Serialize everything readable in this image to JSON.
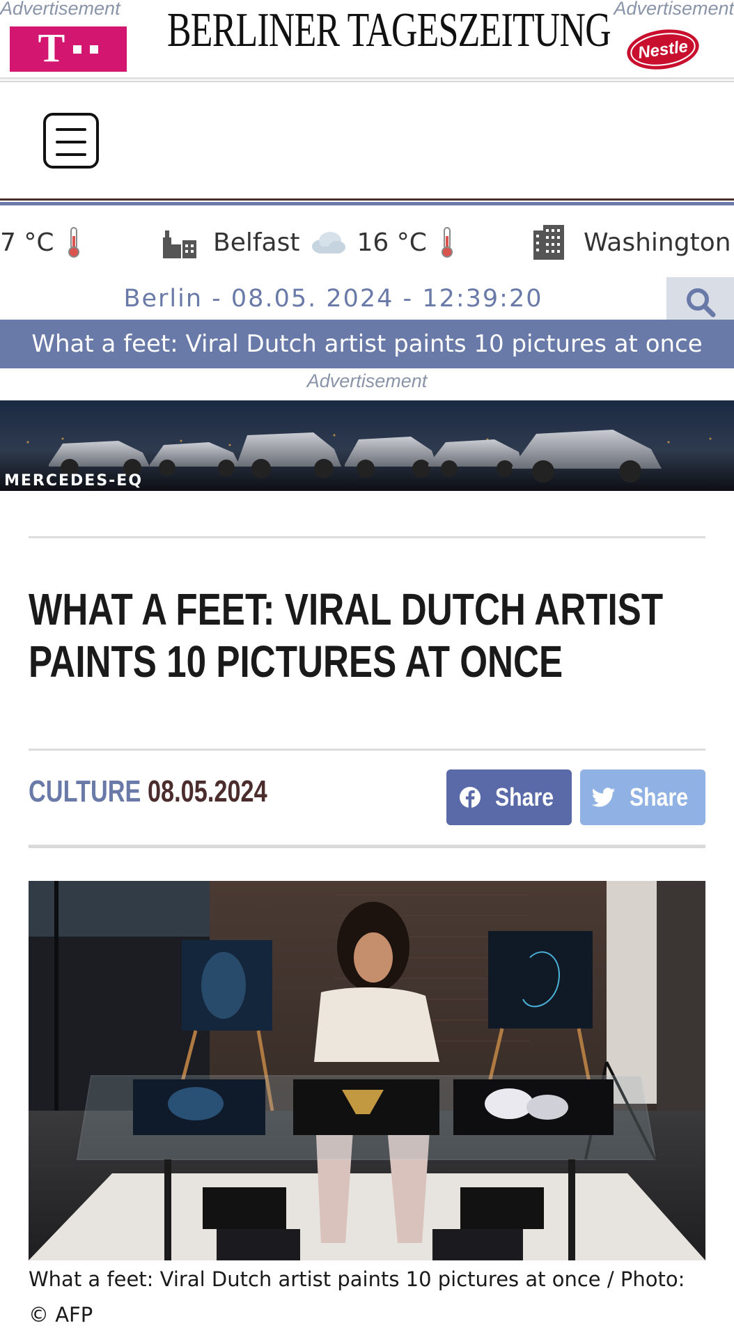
{
  "header": {
    "ad_label_left": "Advertisement",
    "ad_label_right": "Advertisement",
    "brand_title": "BERLINER TAGESZEITUNG",
    "left_ad_logo": "T",
    "right_ad_logo": "Nestle"
  },
  "weather": [
    {
      "city": "",
      "temp": "7 °C",
      "city_icon": "",
      "weather_icon": "",
      "temp_icon": "thermometer-icon"
    },
    {
      "city": "Belfast",
      "temp": "16 °C",
      "city_icon": "city-skyline-icon",
      "weather_icon": "cloud-icon",
      "temp_icon": "thermometer-icon"
    },
    {
      "city": "Washington",
      "temp": "",
      "city_icon": "building-icon",
      "weather_icon": "",
      "temp_icon": ""
    }
  ],
  "datebar": {
    "text": "Berlin - 08.05. 2024 - 12:39:20"
  },
  "ticker": {
    "text": "What a feet: Viral Dutch artist paints 10 pictures at once"
  },
  "middle_ad": {
    "label": "Advertisement",
    "banner_text": "MERCEDES-EQ"
  },
  "article": {
    "headline": "What a feet: Viral Dutch artist paints 10 pictures at once",
    "category": "CULTURE",
    "date": "08.05.2024",
    "share_facebook": "Share",
    "share_twitter": "Share",
    "caption": "What a feet: Viral Dutch artist paints 10 pictures at once / Photo: © AFP"
  },
  "colors": {
    "accent": "#6a7aa8",
    "accent_dark": "#4a2d2c",
    "facebook": "#5a6aa8",
    "twitter": "#8fb1e3",
    "telekom": "#d3166f",
    "nestle": "#c8102e"
  }
}
